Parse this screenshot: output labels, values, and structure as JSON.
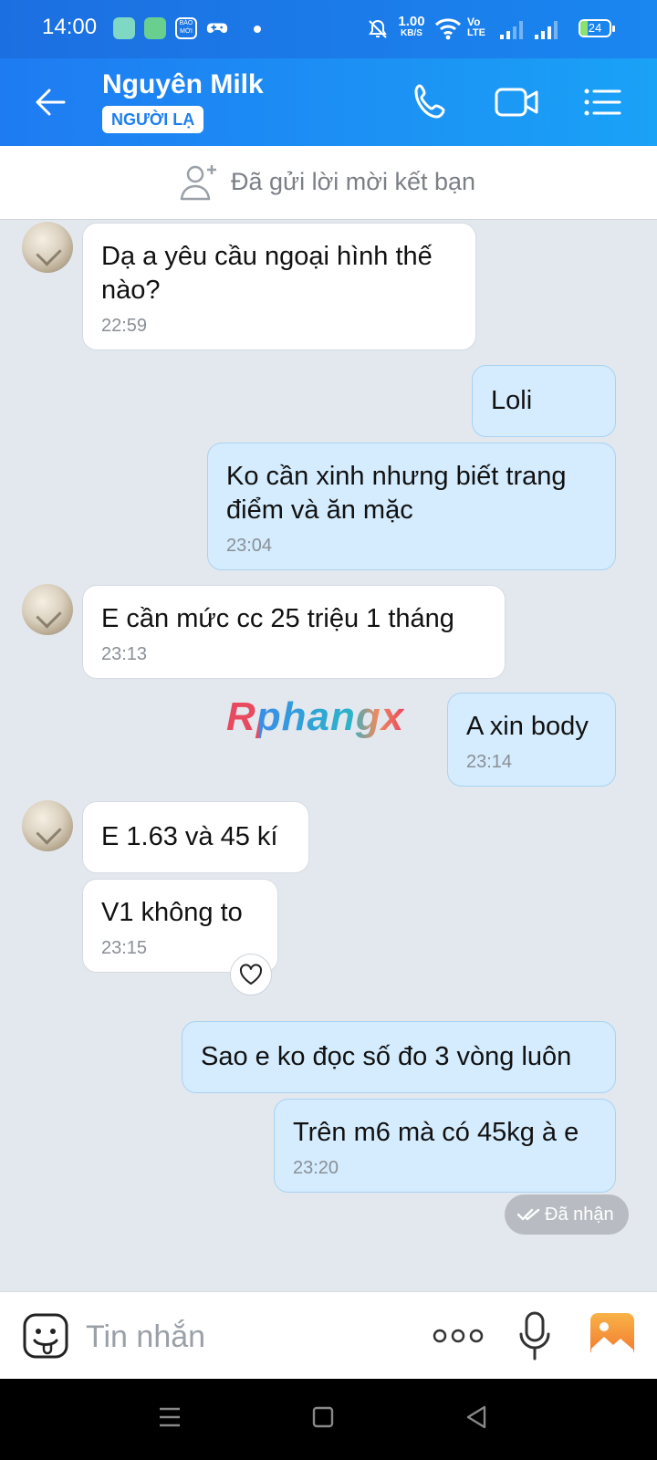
{
  "status_bar": {
    "time": "14:00",
    "net_speed_top": "1.00",
    "net_speed_bottom": "KB/S",
    "volte_top": "Vo",
    "volte_bottom": "LTE",
    "battery": "24"
  },
  "header": {
    "contact_name": "Nguyên Milk",
    "badge": "NGƯỜI LẠ",
    "gradient_start": "#1e7bf2",
    "gradient_end": "#1aa2f6"
  },
  "friend_request": {
    "text": "Đã gửi lời mời kết bạn"
  },
  "messages": [
    {
      "direction": "in",
      "text": "Dạ a yêu cầu ngoại hình thế nào?",
      "time": "22:59"
    },
    {
      "direction": "out",
      "text": "Loli",
      "time": ""
    },
    {
      "direction": "out",
      "text": "Ko cần xinh nhưng biết trang điểm và ăn mặc",
      "time": "23:04"
    },
    {
      "direction": "in",
      "text": "E cần mức cc 25 triệu 1 tháng",
      "time": "23:13"
    },
    {
      "direction": "out",
      "text": "A xin body",
      "time": "23:14"
    },
    {
      "direction": "in",
      "text": "E 1.63 và 45 kí",
      "time": ""
    },
    {
      "direction": "in",
      "text": "V1 không to",
      "time": "23:15"
    },
    {
      "direction": "out",
      "text": "Sao e ko đọc số đo 3 vòng luôn",
      "time": ""
    },
    {
      "direction": "out",
      "text": "Trên m6 mà có 45kg à e",
      "time": "23:20"
    }
  ],
  "watermark": "Rphangx",
  "receipt": {
    "text": "Đã nhận"
  },
  "input": {
    "placeholder": "Tin nhắn"
  },
  "colors": {
    "incoming_bubble": "#ffffff",
    "outgoing_bubble": "#d4ecfe",
    "chat_background": "#e3e8ef",
    "accent": "#1c7ff0"
  }
}
